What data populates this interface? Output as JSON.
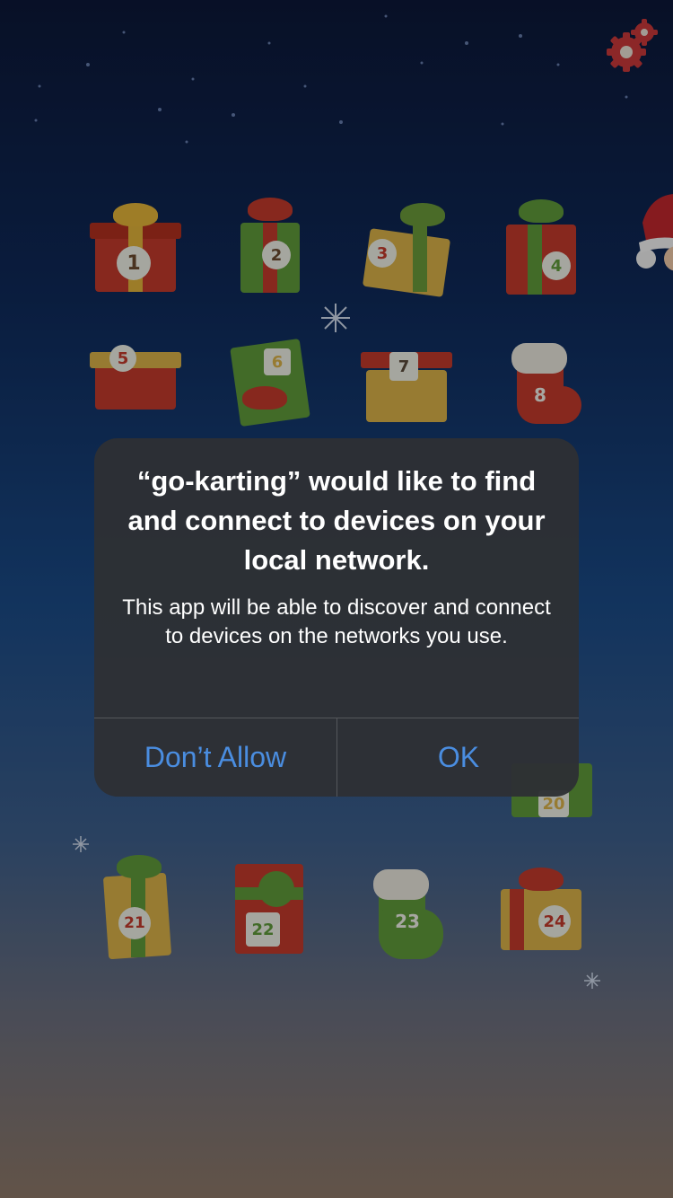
{
  "background": {
    "top_color": "#0c1838",
    "bottom_color": "#8d7868"
  },
  "advent_items": [
    {
      "number": "1"
    },
    {
      "number": "2"
    },
    {
      "number": "3"
    },
    {
      "number": "4"
    },
    {
      "number": "5"
    },
    {
      "number": "6"
    },
    {
      "number": "7"
    },
    {
      "number": "8"
    },
    {
      "number": "20"
    },
    {
      "number": "21"
    },
    {
      "number": "22"
    },
    {
      "number": "23"
    },
    {
      "number": "24"
    }
  ],
  "icons": {
    "settings": "gear-icon",
    "decoration": "santa-icon"
  },
  "alert": {
    "title": "“go-karting” would like to find and connect to devices on your local network.",
    "message": "This app will be able to discover and connect to devices on the networks you use.",
    "deny_label": "Don’t Allow",
    "ok_label": "OK",
    "button_color": "#4a8de0"
  }
}
